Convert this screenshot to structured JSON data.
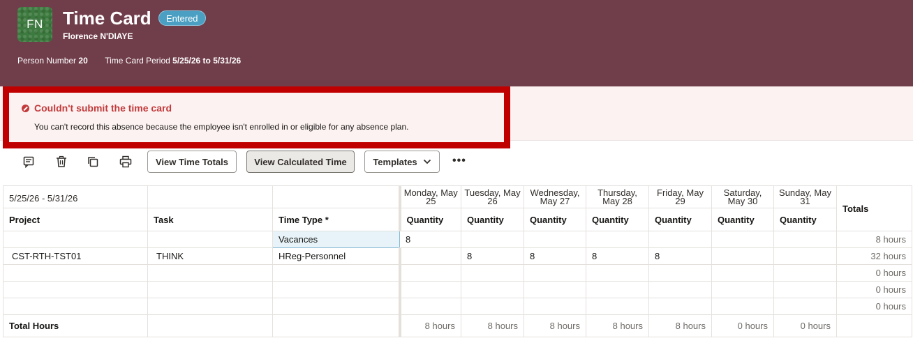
{
  "header": {
    "avatar_initials": "FN",
    "title": "Time Card",
    "status": "Entered",
    "person_name": "Florence N'DIAYE",
    "person_number_label": "Person Number",
    "person_number": "20",
    "period_label": "Time Card Period",
    "period": "5/25/26 to 5/31/26"
  },
  "error": {
    "title": "Couldn't submit the time card",
    "message": "You can't record this absence because the employee isn't enrolled in or eligible for any absence plan."
  },
  "toolbar": {
    "icons": [
      "comment-icon",
      "delete-icon",
      "copy-icon",
      "print-icon"
    ],
    "view_time_totals": "View Time Totals",
    "view_calculated_time": "View Calculated Time",
    "templates": "Templates",
    "more": "•••"
  },
  "grid": {
    "period": "5/25/26 - 5/31/26",
    "days": [
      "Monday, May 25",
      "Tuesday, May 26",
      "Wednesday, May 27",
      "Thursday, May 28",
      "Friday, May 29",
      "Saturday, May 30",
      "Sunday, May 31"
    ],
    "totals_header": "Totals",
    "columns": {
      "project": "Project",
      "task": "Task",
      "time_type": "Time Type *",
      "quantity": "Quantity"
    },
    "rows": [
      {
        "project": "",
        "task": "",
        "time_type": "Vacances",
        "q": [
          "8",
          "",
          "",
          "",
          "",
          "",
          ""
        ],
        "total": "8 hours"
      },
      {
        "project": "CST-RTH-TST01",
        "task": "THINK",
        "time_type": "HReg-Personnel",
        "q": [
          "",
          "8",
          "8",
          "8",
          "8",
          "",
          ""
        ],
        "total": "32 hours"
      },
      {
        "project": "",
        "task": "",
        "time_type": "",
        "q": [
          "",
          "",
          "",
          "",
          "",
          "",
          ""
        ],
        "total": "0 hours"
      },
      {
        "project": "",
        "task": "",
        "time_type": "",
        "q": [
          "",
          "",
          "",
          "",
          "",
          "",
          ""
        ],
        "total": "0 hours"
      },
      {
        "project": "",
        "task": "",
        "time_type": "",
        "q": [
          "",
          "",
          "",
          "",
          "",
          "",
          ""
        ],
        "total": "0 hours"
      }
    ],
    "total_label": "Total Hours",
    "day_totals": [
      "8 hours",
      "8 hours",
      "8 hours",
      "8 hours",
      "8 hours",
      "0 hours",
      "0 hours"
    ]
  }
}
